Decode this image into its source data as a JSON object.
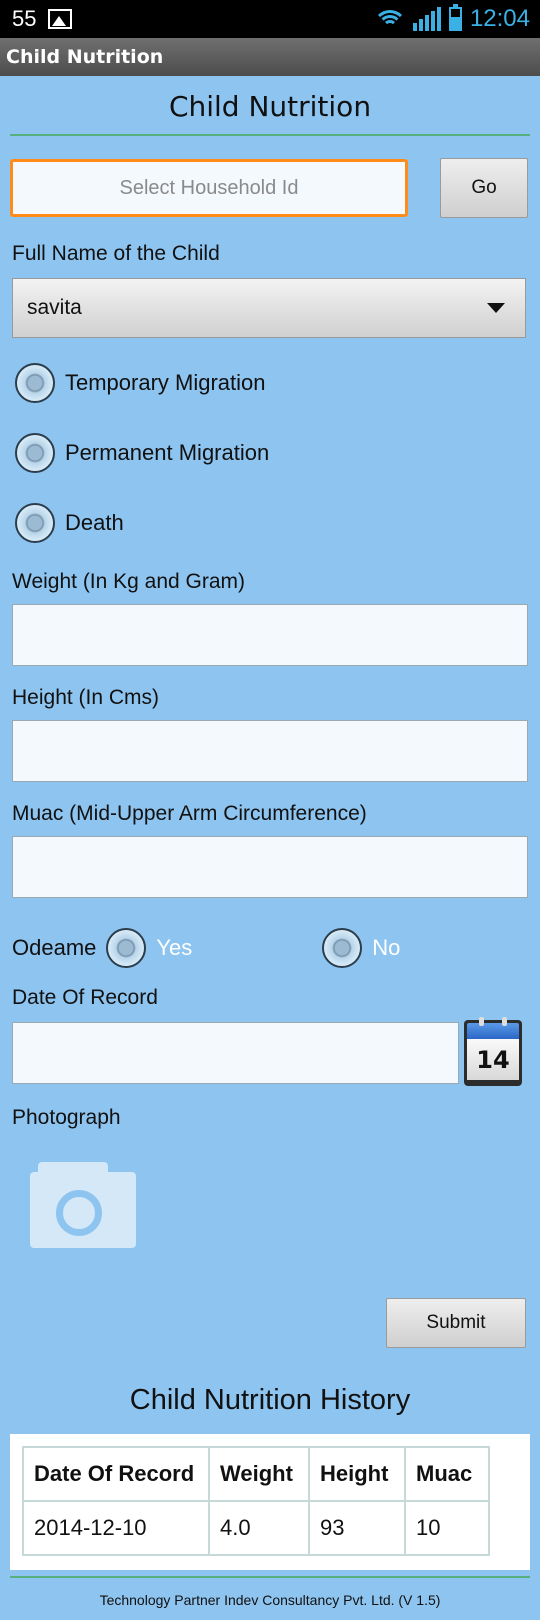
{
  "status_bar": {
    "notification_count": "55",
    "time": "12:04"
  },
  "app_bar": {
    "title": "Child Nutrition"
  },
  "form": {
    "title": "Child Nutrition",
    "household": {
      "placeholder": "Select Household Id",
      "go_label": "Go"
    },
    "child_name": {
      "label": "Full Name of the Child",
      "selected": "savita"
    },
    "status_options": [
      "Temporary Migration",
      "Permanent Migration",
      "Death"
    ],
    "weight_label": "Weight (In Kg and Gram)",
    "height_label": "Height (In Cms)",
    "muac_label": "Muac (Mid-Upper Arm Circumference)",
    "odeame": {
      "label": "Odeame",
      "yes": "Yes",
      "no": "No"
    },
    "date_label": "Date Of Record",
    "calendar_day": "14",
    "photo_label": "Photograph",
    "submit_label": "Submit"
  },
  "history": {
    "title": "Child Nutrition History",
    "columns": [
      "Date Of Record",
      "Weight",
      "Height",
      "Muac"
    ],
    "rows": [
      [
        "2014-12-10",
        "4.0",
        "93",
        "10"
      ]
    ]
  },
  "footer": "Technology Partner Indev Consultancy Pvt. Ltd. (V 1.5)",
  "icons": {
    "status_left": [
      "image-icon"
    ],
    "status_right": [
      "wifi-icon",
      "signal-icon",
      "battery-icon"
    ],
    "spinner": "chevron-down-icon",
    "date": "calendar-icon",
    "photo": "camera-icon"
  },
  "colors": {
    "background": "#8ec4f0",
    "focus_border": "#ff8c1a",
    "divider": "#57b080",
    "status_accent": "#3ab0e5"
  }
}
